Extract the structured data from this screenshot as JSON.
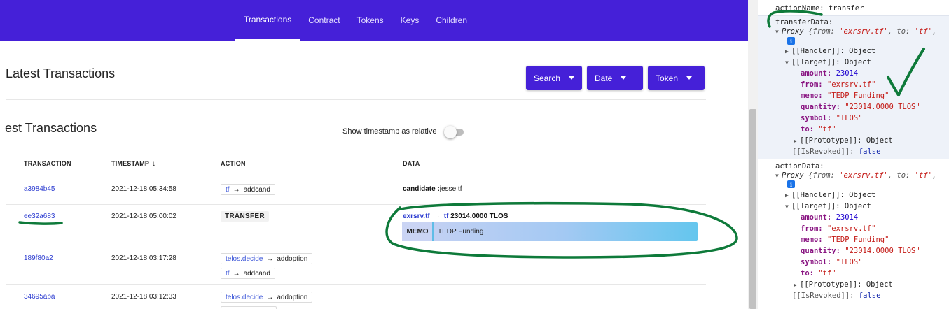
{
  "nav": {
    "tabs": [
      {
        "label": "Transactions",
        "active": true
      },
      {
        "label": "Contract",
        "active": false
      },
      {
        "label": "Tokens",
        "active": false
      },
      {
        "label": "Keys",
        "active": false
      },
      {
        "label": "Children",
        "active": false
      }
    ]
  },
  "latest": {
    "title": "Latest Transactions",
    "filters": {
      "search": "Search",
      "date": "Date",
      "token": "Token"
    }
  },
  "section": {
    "title": "est Transactions",
    "toggle_label": "Show timestamp as relative"
  },
  "table": {
    "headers": {
      "transaction": "TRANSACTION",
      "timestamp": "TIMESTAMP",
      "action": "ACTION",
      "data": "DATA"
    },
    "rows": [
      {
        "tx": "a3984b45",
        "time": "2021-12-18 05:34:58",
        "action_acct": "tf",
        "action_name": "addcand",
        "data_key": "candidate :",
        "data_val": "jesse.tf"
      },
      {
        "tx": "ee32a683",
        "time": "2021-12-18 05:00:02",
        "badge": "TRANSFER",
        "from": "exrsrv.tf",
        "to": "tf",
        "quantity": "23014.0000 TLOS",
        "memo_label": "MEMO",
        "memo": "TEDP Funding"
      },
      {
        "tx": "189f80a2",
        "time": "2021-12-18 03:17:28",
        "action_acct": "telos.decide",
        "action_name": "addoption",
        "action2_acct": "tf",
        "action2_name": "addcand"
      },
      {
        "tx": "34695aba",
        "time": "2021-12-18 03:12:33",
        "action_acct": "telos.decide",
        "action_name": "addoption"
      }
    ]
  },
  "arrow": "→",
  "sort_arrow": "↓",
  "devtools": {
    "action_name_line": "actionName: transfer",
    "transfer": {
      "label": "transferData:",
      "proxy_kw": "Proxy",
      "proxy_preview_a": " {from: ",
      "proxy_from": "'exrsrv.tf'",
      "proxy_preview_b": ", to: ",
      "proxy_to": "'tf'",
      "proxy_preview_c": ",",
      "handler": "[[Handler]]: Object",
      "target": "[[Target]]: Object",
      "fields": [
        {
          "key": "amount:",
          "value": "23014",
          "kind": "number"
        },
        {
          "key": "from:",
          "value": "\"exrsrv.tf\"",
          "kind": "string"
        },
        {
          "key": "memo:",
          "value": "\"TEDP Funding\"",
          "kind": "string"
        },
        {
          "key": "quantity:",
          "value": "\"23014.0000 TLOS\"",
          "kind": "string"
        },
        {
          "key": "symbol:",
          "value": "\"TLOS\"",
          "kind": "string"
        },
        {
          "key": "to:",
          "value": "\"tf\"",
          "kind": "string"
        }
      ],
      "prototype": "[[Prototype]]: Object",
      "revoked_key": "[[IsRevoked]]:",
      "revoked_val": "false"
    },
    "action": {
      "label": "actionData:",
      "proxy_kw": "Proxy",
      "proxy_preview_a": " {from: ",
      "proxy_from": "'exrsrv.tf'",
      "proxy_preview_b": ", to: ",
      "proxy_to": "'tf'",
      "proxy_preview_c": ",",
      "handler": "[[Handler]]: Object",
      "target": "[[Target]]: Object",
      "fields": [
        {
          "key": "amount:",
          "value": "23014",
          "kind": "number"
        },
        {
          "key": "from:",
          "value": "\"exrsrv.tf\"",
          "kind": "string"
        },
        {
          "key": "memo:",
          "value": "\"TEDP Funding\"",
          "kind": "string"
        },
        {
          "key": "quantity:",
          "value": "\"23014.0000 TLOS\"",
          "kind": "string"
        },
        {
          "key": "symbol:",
          "value": "\"TLOS\"",
          "kind": "string"
        },
        {
          "key": "to:",
          "value": "\"tf\"",
          "kind": "string"
        }
      ],
      "prototype": "[[Prototype]]: Object",
      "revoked_key": "[[IsRevoked]]:",
      "revoked_val": "false"
    },
    "info_glyph": "i",
    "expand_glyph": "▼",
    "collapse_glyph": "▶"
  },
  "colors": {
    "brand": "#4520d8",
    "annotation": "#0e7a3a"
  }
}
